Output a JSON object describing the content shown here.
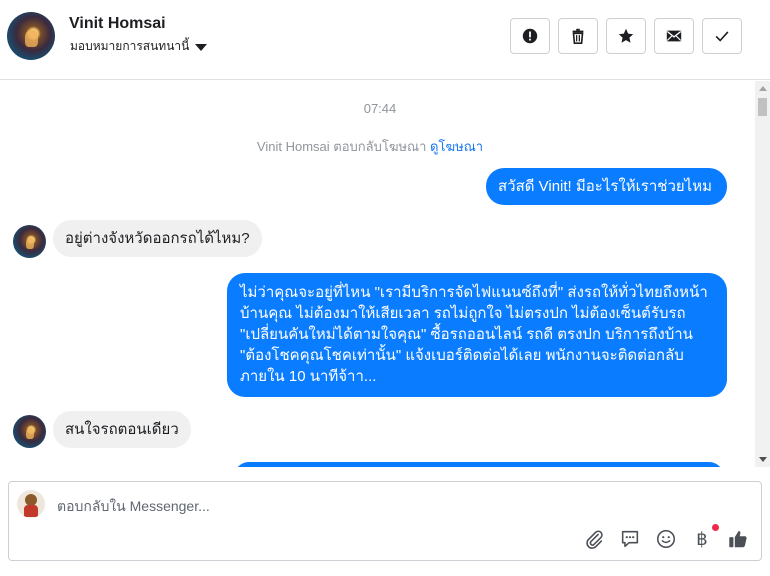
{
  "header": {
    "contact_name": "Vinit Homsai",
    "assign_label": "มอบหมายการสนทนานี้",
    "actions": [
      {
        "name": "report-spam-button",
        "icon": "exclamation-circle-icon"
      },
      {
        "name": "delete-button",
        "icon": "trash-icon"
      },
      {
        "name": "star-button",
        "icon": "star-icon"
      },
      {
        "name": "mark-unread-button",
        "icon": "envelope-icon"
      },
      {
        "name": "mark-done-button",
        "icon": "checkmark-icon"
      }
    ]
  },
  "conversation": {
    "timestamp": "07:44",
    "ad_reply_text": "Vinit Homsai ตอบกลับโฆษณา",
    "ad_link_text": "ดูโฆษณา",
    "messages": [
      {
        "direction": "outgoing",
        "text": "สวัสดี Vinit! มีอะไรให้เราช่วยไหม"
      },
      {
        "direction": "incoming",
        "text": "อยู่ต่างจังหวัดออกรถได้ไหม?"
      },
      {
        "direction": "outgoing",
        "text": "ไม่ว่าคุณจะอยู่ที่ไหน \"เรามีบริการจัดไฟแนนซ์ถึงที่\"  ส่งรถให้ทั่วไทยถึงหน้าบ้านคุณ ไม่ต้องมาให้เสียเวลา รถไม่ถูกใจ ไม่ตรงปก ไม่ต้องเซ็นต์รับรถ \"เปลี่ยนคันใหม่ได้ตามใจคุณ\" ซื้อรถออนไลน์ รถดี ตรงปก บริการถึงบ้าน \"ต้องโชคคุณโชคเท่านั้น\" แจ้งเบอร์ติดต่อได้เลย พนักงานจะติดต่อกลับภายใน 10 นาทีจ้าา..."
      },
      {
        "direction": "incoming",
        "text": "สนใจรถตอนเดียว"
      },
      {
        "direction": "outgoing",
        "text": ""
      }
    ]
  },
  "composer": {
    "placeholder": "ตอบกลับใน Messenger...",
    "tools": [
      "paperclip-icon",
      "chat-bubble-icon",
      "smiley-icon",
      "baht-icon",
      "thumbs-up-icon"
    ],
    "baht_symbol": "฿"
  },
  "colors": {
    "outgoing_bubble": "#0a7cff",
    "incoming_bubble": "#f0f0f0",
    "link": "#1877f2",
    "notification_dot": "#f02849"
  }
}
